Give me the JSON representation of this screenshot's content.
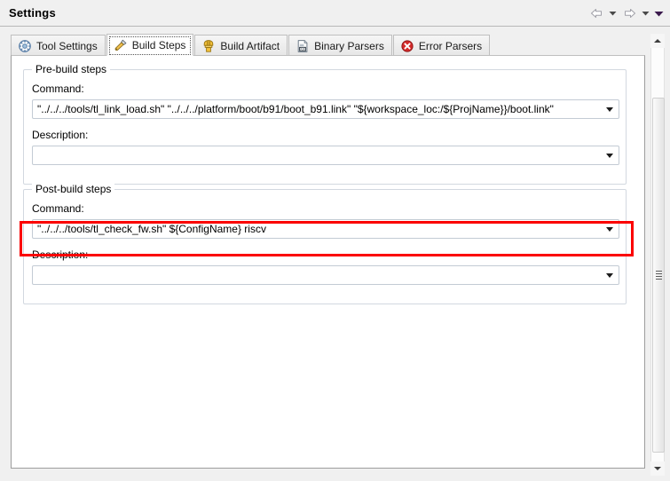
{
  "window": {
    "title": "Settings"
  },
  "navigation": {
    "back_icon": "back-arrow-icon",
    "back_menu_icon": "chevron-down-icon",
    "forward_icon": "forward-arrow-icon",
    "forward_menu_icon": "chevron-down-icon",
    "overflow_icon": "view-menu-icon"
  },
  "tabs": [
    {
      "label": "Tool Settings",
      "icon": "tool-settings-icon",
      "active": false
    },
    {
      "label": "Build Steps",
      "icon": "build-steps-icon",
      "active": true
    },
    {
      "label": "Build Artifact",
      "icon": "build-artifact-icon",
      "active": false
    },
    {
      "label": "Binary Parsers",
      "icon": "binary-parsers-icon",
      "active": false
    },
    {
      "label": "Error Parsers",
      "icon": "error-parsers-icon",
      "active": false
    }
  ],
  "prebuild": {
    "group_title": "Pre-build steps",
    "command_label": "Command:",
    "command_value": "\"../../../tools/tl_link_load.sh\" \"../../../platform/boot/b91/boot_b91.link\" \"${workspace_loc:/${ProjName}}/boot.link\"",
    "command_placeholder": "",
    "description_label": "Description:",
    "description_value": "",
    "description_placeholder": ""
  },
  "postbuild": {
    "group_title": "Post-build steps",
    "command_label": "Command:",
    "command_value": "\"../../../tools/tl_check_fw.sh\" ${ConfigName} riscv",
    "command_placeholder": "",
    "description_label": "Description:",
    "description_value": "",
    "description_placeholder": ""
  },
  "annotation": {
    "highlight_color": "#fb0000",
    "target": "post-build-command-combo"
  },
  "scrollbar": {
    "up_icon": "scroll-up-arrow-icon",
    "down_icon": "scroll-down-arrow-icon"
  }
}
